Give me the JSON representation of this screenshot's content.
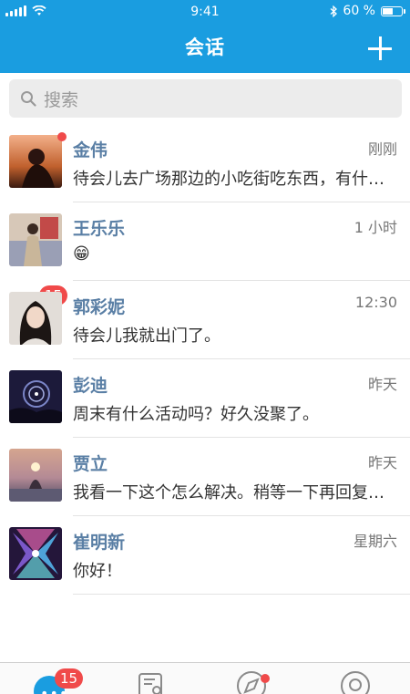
{
  "status_bar": {
    "time": "9:41",
    "battery": "60 %",
    "battery_level": 0.6,
    "bluetooth_icon": "bluetooth-icon"
  },
  "header": {
    "title": "会话",
    "add_icon": "plus-icon"
  },
  "search": {
    "placeholder": "搜索",
    "icon": "search-icon"
  },
  "conversations": [
    {
      "name": "金伟",
      "time": "刚刚",
      "message": "待会儿去广场那边的小吃街吃东西，有什么想吃的吗",
      "unread_dot": true
    },
    {
      "name": "王乐乐",
      "time": "1 小时",
      "message": "😁",
      "badge": "15"
    },
    {
      "name": "郭彩妮",
      "time": "12:30",
      "message": "待会儿我就出门了。"
    },
    {
      "name": "彭迪",
      "time": "昨天",
      "message": "周末有什么活动吗？好久没聚了。"
    },
    {
      "name": "贾立",
      "time": "昨天",
      "message": "我看一下这个怎么解决。稍等一下再回复你吧"
    },
    {
      "name": "崔明新",
      "time": "星期六",
      "message": "你好！"
    }
  ],
  "tab_bar": {
    "tabs": [
      {
        "icon": "chat-icon",
        "badge": "15"
      },
      {
        "icon": "contacts-icon"
      },
      {
        "icon": "discover-compass-icon",
        "dot": true
      },
      {
        "icon": "profile-icon"
      }
    ]
  },
  "colors": {
    "accent": "#1a9de0",
    "badge": "#f04a4a",
    "name": "#5a7fa5"
  }
}
